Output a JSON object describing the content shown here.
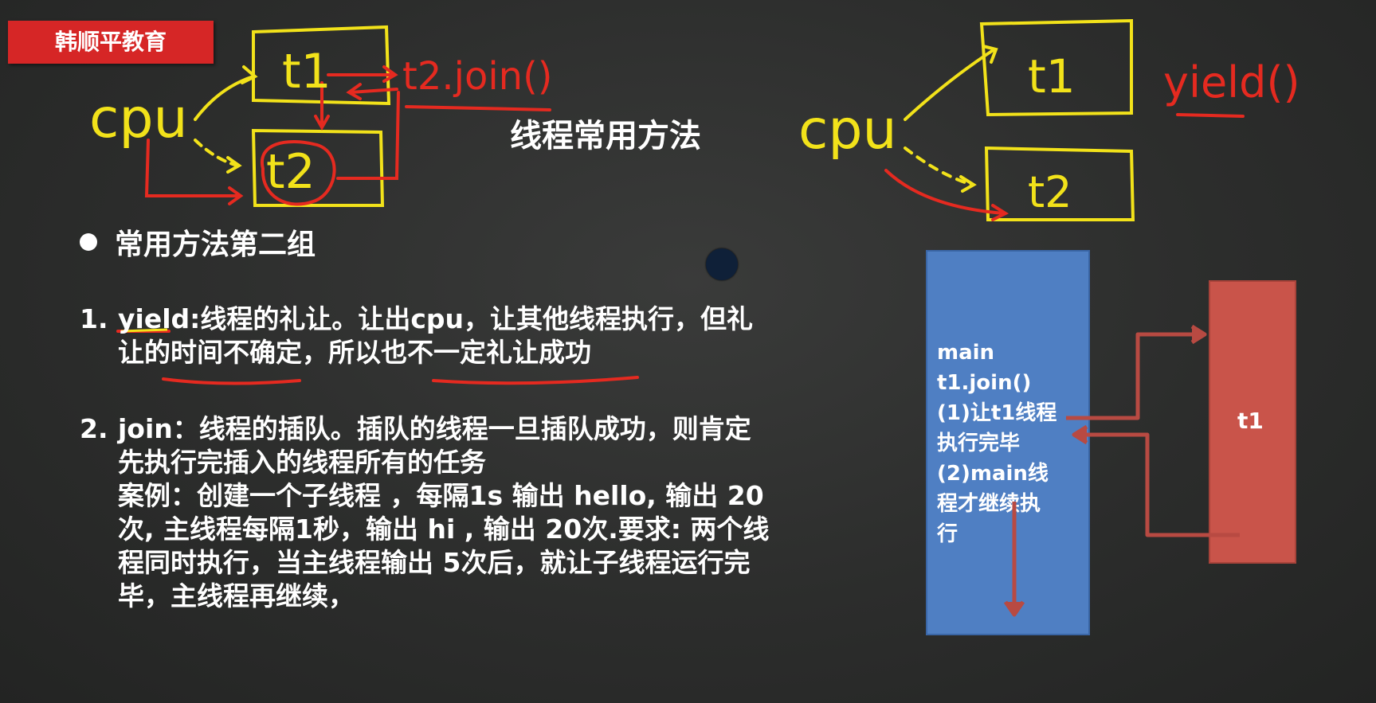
{
  "brand": "韩顺平教育",
  "title": "线程常用方法",
  "section_title": "常用方法第二组",
  "items": [
    {
      "number": "1.",
      "lines": [
        "yield:线程的礼让。让出cpu，让其他线程执行，但礼",
        "让的时间不确定，所以也不一定礼让成功"
      ]
    },
    {
      "number": "2.",
      "lines": [
        "join：线程的插队。插队的线程一旦插队成功，则肯定",
        "先执行完插入的线程所有的任务",
        "案例：创建一个子线程 ，每隔1s 输出 hello, 输出 20",
        "次, 主线程每隔1秒，输出 hi , 输出 20次.要求: 两个线",
        "程同时执行，当主线程输出 5次后，就让子线程运行完",
        "毕，主线程再继续，"
      ]
    }
  ],
  "diagram": {
    "main_lines": [
      "main",
      "t1.join()",
      "(1)让t1线程",
      "执行完毕",
      "(2)main线",
      "程才继续执",
      "行"
    ],
    "t1_label": "t1"
  },
  "handwriting": {
    "left_cpu": "cpu",
    "left_t1": "t1",
    "left_t2": "t2",
    "left_join": "t2.join()",
    "right_cpu": "cpu",
    "right_t1": "t1",
    "right_t2": "t2",
    "right_yield": "yield()"
  },
  "colors": {
    "brand_red": "#d62626",
    "chalk_yellow": "#f2e21a",
    "chalk_red": "#e52a20",
    "main_box_blue": "#4f7fc3",
    "t1_box_red": "#c9544a",
    "arrow_brown": "#b84a42"
  }
}
